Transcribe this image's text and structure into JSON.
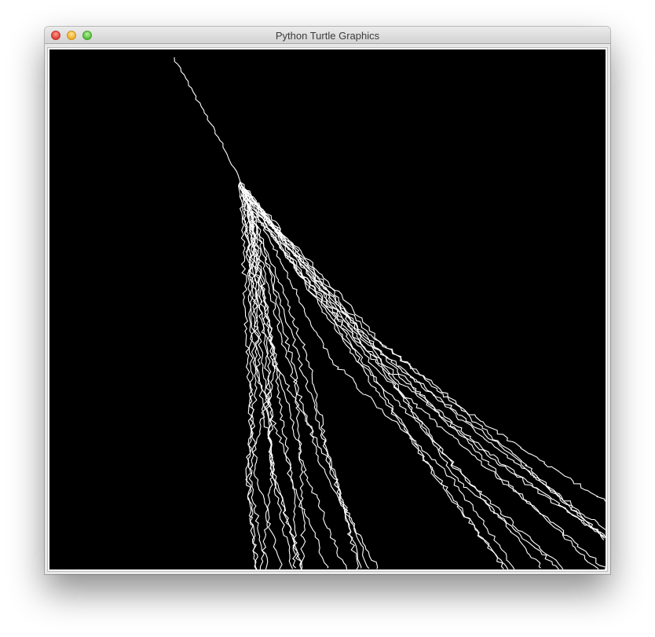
{
  "window": {
    "title": "Python Turtle Graphics"
  },
  "canvas": {
    "background_color": "#000000",
    "stroke_color": "#ffffff",
    "drawing_description_icon": "random-walk-strands-icon"
  }
}
